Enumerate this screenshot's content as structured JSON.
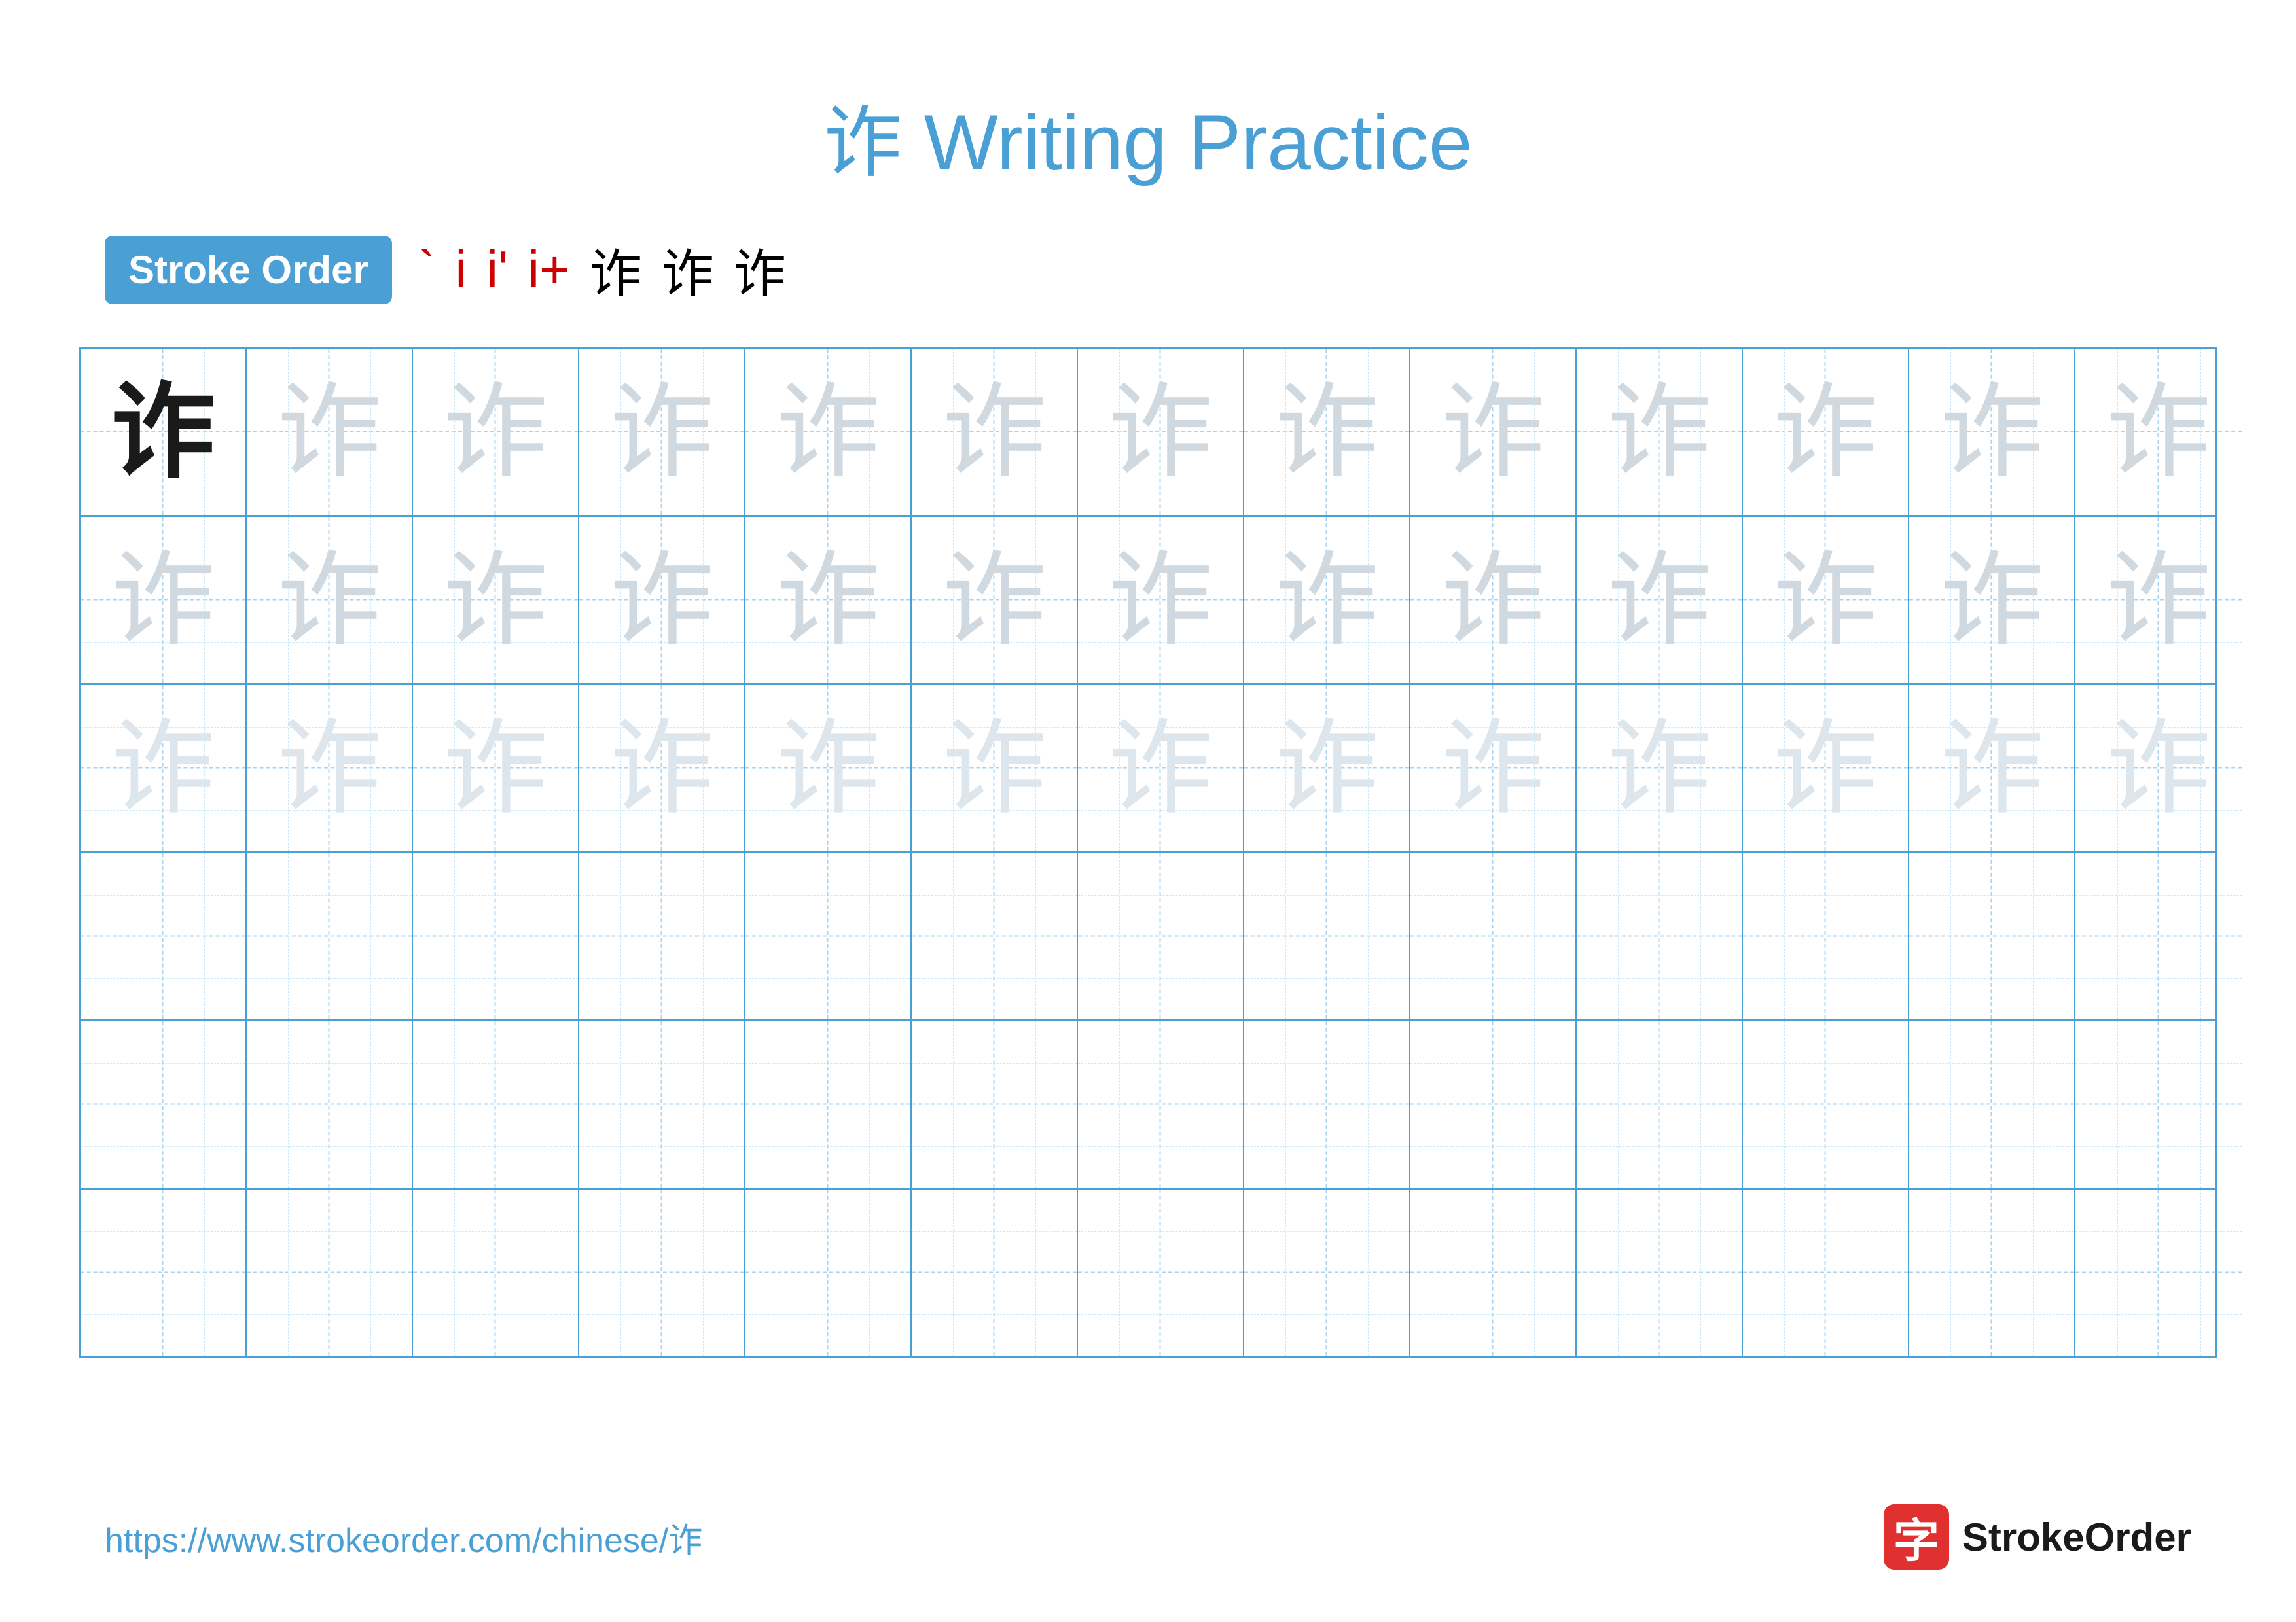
{
  "title": "诈 Writing Practice",
  "stroke_order": {
    "label": "Stroke Order",
    "strokes": [
      "`",
      "i",
      "i'",
      "i+",
      "诈",
      "诈",
      "诈"
    ]
  },
  "character": "诈",
  "grid": {
    "rows": 6,
    "cols": 13,
    "row_styles": [
      "dark_then_light",
      "all_light",
      "all_lighter",
      "empty",
      "empty",
      "empty"
    ]
  },
  "footer": {
    "url": "https://www.strokeorder.com/chinese/诈",
    "logo_text": "StrokeOrder",
    "logo_char": "字"
  }
}
